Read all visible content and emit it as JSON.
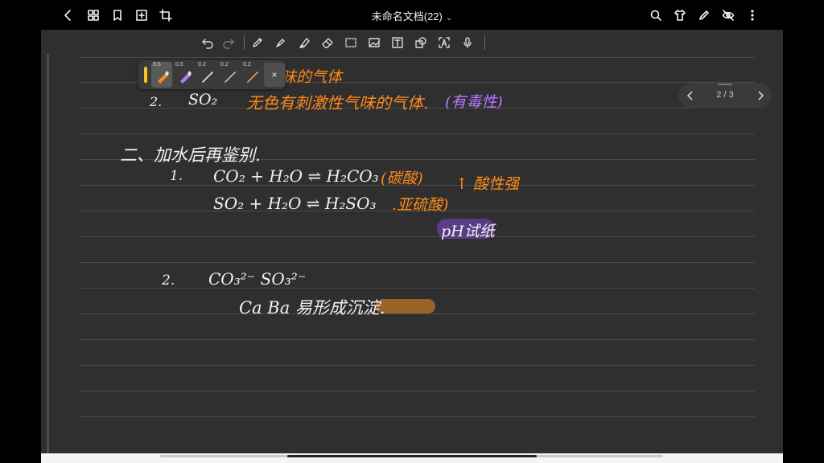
{
  "header": {
    "title": "未命名文档(22)",
    "title_chevron": "⌄",
    "left_icons": [
      "back-icon",
      "grid-icon",
      "bookmark-icon",
      "add-page-icon",
      "crop-icon"
    ],
    "right_icons": [
      "search-icon",
      "shirt-icon",
      "pen-icon",
      "eye-off-icon",
      "more-vertical-icon"
    ]
  },
  "drawing_toolbar": {
    "tools": [
      "undo-icon",
      "redo-icon",
      "pencil-icon",
      "fountain-pen-icon",
      "highlighter-icon",
      "eraser-icon",
      "lasso-icon",
      "image-icon",
      "text-box-icon",
      "shape-icon",
      "ocr-text-icon",
      "microphone-icon"
    ]
  },
  "pen_palette": {
    "active_color": "#f3c623",
    "pens": [
      {
        "size": "0.5",
        "color": "#ff8a1a",
        "active": true
      },
      {
        "size": "0.5",
        "color": "#b779ff",
        "active": false
      },
      {
        "size": "0.2",
        "color": "#ffffff",
        "active": false
      },
      {
        "size": "0.2",
        "color": "#d7c8ff",
        "active": false
      },
      {
        "size": "0.2",
        "color": "#ffb04a",
        "active": false
      }
    ],
    "close_label": "×"
  },
  "page_nav": {
    "label": "2 / 3"
  },
  "notes": {
    "line_top_fragment": "味的气体",
    "item2_num": "2.",
    "item2_formula": "SO₂",
    "item2_desc": "无色有刺激性气味的气体.",
    "item2_note": "(有毒性)",
    "section_title": "二、加水后再鉴别.",
    "eq_num": "1.",
    "eq1": "CO₂ + H₂O ⇌ H₂CO₃",
    "eq1_note": "(碳酸)",
    "eq_arrow_note": "↑ 酸性强",
    "eq2": "SO₂ + H₂O ⇌ H₂SO₃",
    "eq2_note": ".亚硫酸)",
    "ph_note": "pH试纸",
    "ion_num": "2.",
    "ions": "CO₃²⁻   SO₃²⁻",
    "precip": "Ca   Ba   易形成沉淀."
  }
}
